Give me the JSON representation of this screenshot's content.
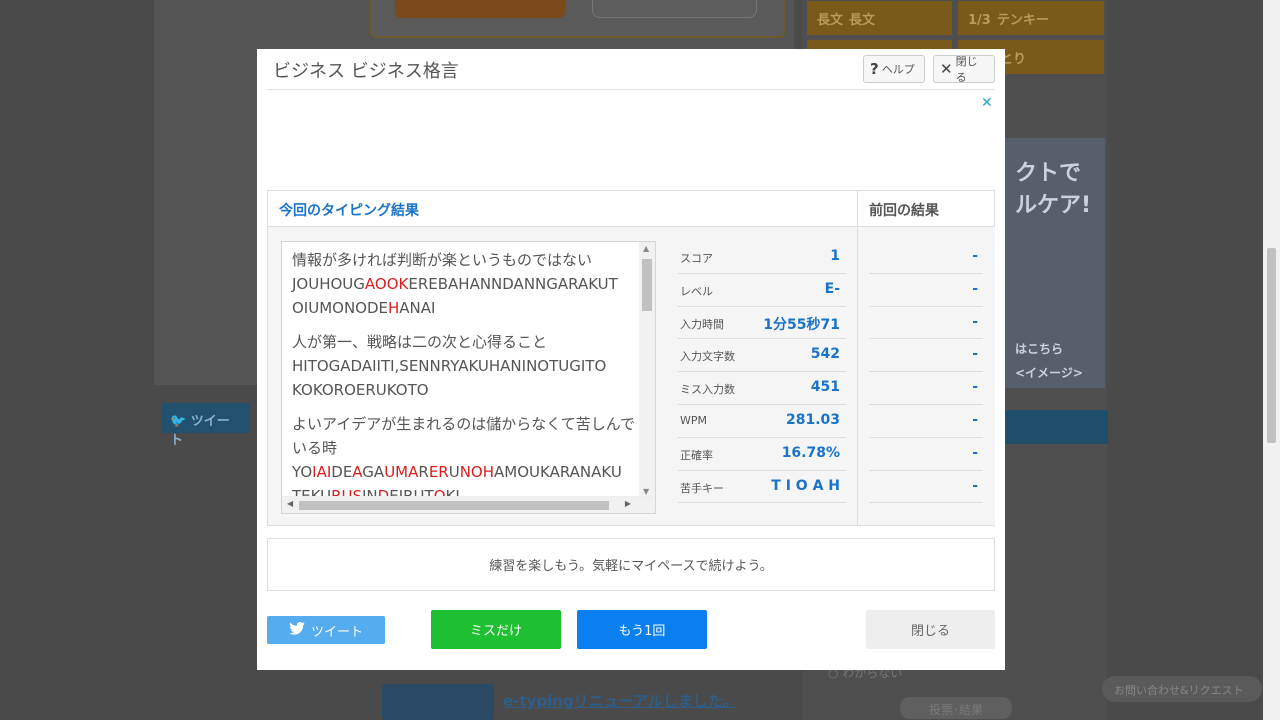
{
  "background": {
    "tiles": [
      {
        "icon": "長文",
        "label": "長文"
      },
      {
        "icon": "1/3",
        "label": "テンキー"
      },
      {
        "icon": "",
        "label": "しりとり"
      }
    ],
    "ad_text_1": "クトで",
    "ad_text_2": "ルケア!",
    "ad_small_1": "はこちら",
    "ad_small_2": "<イメージ>",
    "tweet_label": "ツイート",
    "link_text": "e-typingリニューアルしました。",
    "vote_label": "投票･結果",
    "contact_label": "お問い合わせ&リクエスト",
    "radio_label": "わからない"
  },
  "modal": {
    "title": "ビジネス ビジネス格言",
    "help_label": "ヘルプ",
    "close_top_label": "閉じる",
    "result_heading": "今回のタイピング結果",
    "prev_heading": "前回の結果",
    "texts": [
      {
        "jp": "情報が多ければ判断が楽というものではない",
        "roma1": [
          [
            "JOUHOUG",
            false
          ],
          [
            "AOOK",
            true
          ],
          [
            "EREBAHANNDANNGARAKUT",
            false
          ]
        ],
        "roma2": [
          [
            "OIUMONODE",
            false
          ],
          [
            "H",
            true
          ],
          [
            "ANAI",
            false
          ]
        ]
      },
      {
        "jp": "人が第一、戦略は二の次と心得ること",
        "roma1": [
          [
            "HITOGADAIITI,SENNRYAKUHANINOTUGITO",
            false
          ]
        ],
        "roma2": [
          [
            "KOKOROERUKOTO",
            false
          ]
        ]
      },
      {
        "jp": "よいアイデアが生まれるのは儲からなくて苦しんでいる時",
        "roma1": [
          [
            "YO",
            false
          ],
          [
            "IAI",
            true
          ],
          [
            "DE",
            false
          ],
          [
            "A",
            true
          ],
          [
            "GA",
            false
          ],
          [
            "UMA",
            true
          ],
          [
            "R",
            false
          ],
          [
            "ER",
            true
          ],
          [
            "U",
            false
          ],
          [
            "NOH",
            true
          ],
          [
            "AMOUKARANAKU",
            false
          ]
        ],
        "roma2": [
          [
            "TEKU",
            false
          ],
          [
            "RUS",
            true
          ],
          [
            "IN",
            false
          ],
          [
            "D",
            true
          ],
          [
            "EIRUT",
            false
          ],
          [
            "O",
            true
          ],
          [
            "KI",
            false
          ]
        ]
      }
    ],
    "stats": [
      {
        "label": "スコア",
        "value": "1"
      },
      {
        "label": "レベル",
        "value": "E-"
      },
      {
        "label": "入力時間",
        "value": "1分55秒71"
      },
      {
        "label": "入力文字数",
        "value": "542"
      },
      {
        "label": "ミス入力数",
        "value": "451"
      },
      {
        "label": "WPM",
        "value": "281.03"
      },
      {
        "label": "正確率",
        "value": "16.78%"
      },
      {
        "label": "苦手キー",
        "value": "T I O A H"
      }
    ],
    "prev_stats": [
      "-",
      "-",
      "-",
      "-",
      "-",
      "-",
      "-",
      "-"
    ],
    "message": "練習を楽しもう。気軽にマイペースで続けよう。",
    "tweet_label": "ツイート",
    "miss_only_label": "ミスだけ",
    "again_label": "もう1回",
    "close_label": "閉じる"
  },
  "colors": {
    "accent_blue": "#1a73c9",
    "miss_red": "#d92020",
    "tweet": "#55acee",
    "miss_btn": "#1fbf32",
    "again_btn": "#0a7ff0"
  }
}
